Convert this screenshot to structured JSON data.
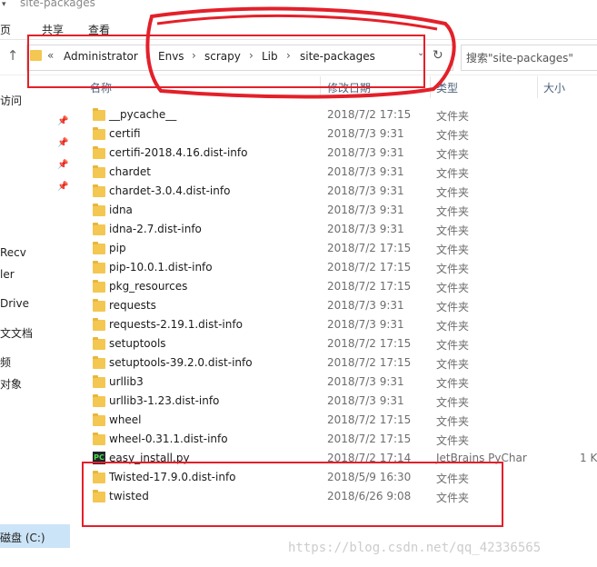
{
  "window": {
    "title": "site-packages"
  },
  "ribbon": {
    "tabs": [
      "页",
      "共享",
      "查看"
    ]
  },
  "address": {
    "prefix": "«",
    "segments": [
      "Administrator",
      "Envs",
      "scrapy",
      "Lib",
      "site-packages"
    ],
    "separator": "›",
    "dropdown": "⌄",
    "refresh": "↻"
  },
  "search": {
    "placeholder": "搜索\"site-packages\""
  },
  "columns": {
    "name": "名称",
    "date": "修改日期",
    "type": "类型",
    "size": "大小"
  },
  "sidebar": {
    "items": [
      "访问",
      "",
      "Recv",
      "ler",
      "Drive",
      "文文档",
      "频",
      "对象"
    ],
    "drive": "磁盘 (C:)"
  },
  "files": [
    {
      "name": "__pycache__",
      "date": "2018/7/2 17:15",
      "type": "文件夹",
      "size": "",
      "icon": "folder-icon"
    },
    {
      "name": "certifi",
      "date": "2018/7/3 9:31",
      "type": "文件夹",
      "size": "",
      "icon": "folder-icon"
    },
    {
      "name": "certifi-2018.4.16.dist-info",
      "date": "2018/7/3 9:31",
      "type": "文件夹",
      "size": "",
      "icon": "folder-icon"
    },
    {
      "name": "chardet",
      "date": "2018/7/3 9:31",
      "type": "文件夹",
      "size": "",
      "icon": "folder-icon"
    },
    {
      "name": "chardet-3.0.4.dist-info",
      "date": "2018/7/3 9:31",
      "type": "文件夹",
      "size": "",
      "icon": "folder-icon"
    },
    {
      "name": "idna",
      "date": "2018/7/3 9:31",
      "type": "文件夹",
      "size": "",
      "icon": "folder-icon"
    },
    {
      "name": "idna-2.7.dist-info",
      "date": "2018/7/3 9:31",
      "type": "文件夹",
      "size": "",
      "icon": "folder-icon"
    },
    {
      "name": "pip",
      "date": "2018/7/2 17:15",
      "type": "文件夹",
      "size": "",
      "icon": "folder-icon"
    },
    {
      "name": "pip-10.0.1.dist-info",
      "date": "2018/7/2 17:15",
      "type": "文件夹",
      "size": "",
      "icon": "folder-icon"
    },
    {
      "name": "pkg_resources",
      "date": "2018/7/2 17:15",
      "type": "文件夹",
      "size": "",
      "icon": "folder-icon"
    },
    {
      "name": "requests",
      "date": "2018/7/3 9:31",
      "type": "文件夹",
      "size": "",
      "icon": "folder-icon"
    },
    {
      "name": "requests-2.19.1.dist-info",
      "date": "2018/7/3 9:31",
      "type": "文件夹",
      "size": "",
      "icon": "folder-icon"
    },
    {
      "name": "setuptools",
      "date": "2018/7/2 17:15",
      "type": "文件夹",
      "size": "",
      "icon": "folder-icon"
    },
    {
      "name": "setuptools-39.2.0.dist-info",
      "date": "2018/7/2 17:15",
      "type": "文件夹",
      "size": "",
      "icon": "folder-icon"
    },
    {
      "name": "urllib3",
      "date": "2018/7/3 9:31",
      "type": "文件夹",
      "size": "",
      "icon": "folder-icon"
    },
    {
      "name": "urllib3-1.23.dist-info",
      "date": "2018/7/3 9:31",
      "type": "文件夹",
      "size": "",
      "icon": "folder-icon"
    },
    {
      "name": "wheel",
      "date": "2018/7/2 17:15",
      "type": "文件夹",
      "size": "",
      "icon": "folder-icon"
    },
    {
      "name": "wheel-0.31.1.dist-info",
      "date": "2018/7/2 17:15",
      "type": "文件夹",
      "size": "",
      "icon": "folder-icon"
    },
    {
      "name": "easy_install.py",
      "date": "2018/7/2 17:14",
      "type": "JetBrains PyChar",
      "size": "1 K",
      "icon": "pycharm-file-icon"
    },
    {
      "name": "Twisted-17.9.0.dist-info",
      "date": "2018/5/9 16:30",
      "type": "文件夹",
      "size": "",
      "icon": "folder-icon"
    },
    {
      "name": "twisted",
      "date": "2018/6/26 9:08",
      "type": "文件夹",
      "size": "",
      "icon": "folder-icon"
    }
  ],
  "annotations": {
    "watermark": "https://blog.csdn.net/qq_42336565",
    "colors": {
      "highlight": "#e3202a",
      "folder": "#f3c752",
      "selected": "#cce4f7"
    }
  }
}
